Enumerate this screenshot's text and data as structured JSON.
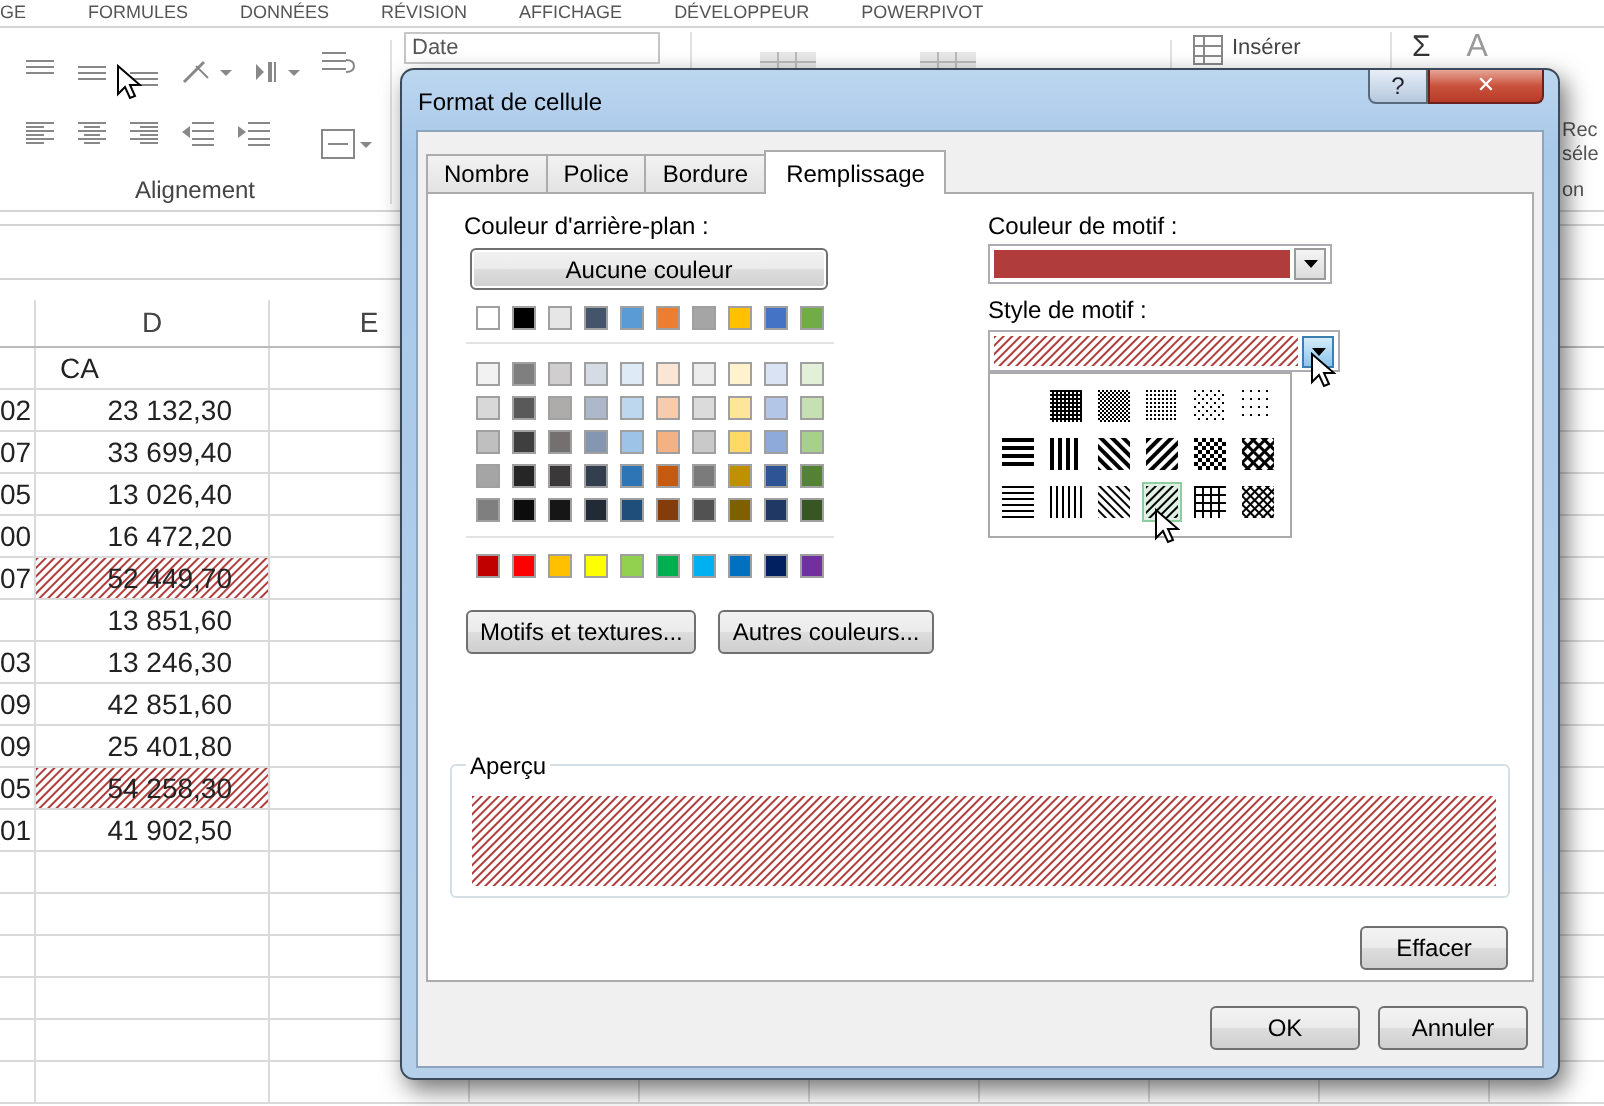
{
  "ribbon": {
    "tabs": [
      "GE",
      "FORMULES",
      "DONNÉES",
      "RÉVISION",
      "AFFICHAGE",
      "DÉVELOPPEUR",
      "POWERPIVOT"
    ],
    "alignment_group": {
      "label": "Alignement"
    },
    "number_format": {
      "value": "Date"
    },
    "insert_button": {
      "label": "Insérer"
    },
    "autosum": {
      "symbol": "Σ"
    },
    "sort": {
      "symbol": "A"
    },
    "editing_texts": [
      "Rec",
      "séle",
      "on"
    ]
  },
  "sheet": {
    "columns": [
      "D",
      "E"
    ],
    "rows": [
      {
        "column_1": "",
        "value": "CA",
        "hatched": false
      },
      {
        "column_1": "02",
        "value": "23 132,30",
        "hatched": false
      },
      {
        "column_1": "07",
        "value": "33 699,40",
        "hatched": false
      },
      {
        "column_1": "05",
        "value": "13 026,40",
        "hatched": false
      },
      {
        "column_1": "00",
        "value": "16 472,20",
        "hatched": false
      },
      {
        "column_1": "07",
        "value": "52 449,70",
        "hatched": true
      },
      {
        "column_1": "",
        "value": "13 851,60",
        "hatched": false
      },
      {
        "column_1": "03",
        "value": "13 246,30",
        "hatched": false
      },
      {
        "column_1": "09",
        "value": "42 851,60",
        "hatched": false
      },
      {
        "column_1": "09",
        "value": "25 401,80",
        "hatched": false
      },
      {
        "column_1": "05",
        "value": "54 258,30",
        "hatched": true
      },
      {
        "column_1": "01",
        "value": "41 902,50",
        "hatched": false
      }
    ]
  },
  "dialog": {
    "title": "Format de cellule",
    "help": "?",
    "close": "✕",
    "tabs": [
      {
        "label": "Nombre",
        "selected": false
      },
      {
        "label": "Police",
        "selected": false
      },
      {
        "label": "Bordure",
        "selected": false
      },
      {
        "label": "Remplissage",
        "selected": true
      }
    ],
    "background_label": "Couleur d'arrière-plan :",
    "no_color_button": "Aucune couleur",
    "theme_colors": [
      {
        "color": "#ffffff"
      },
      {
        "color": "#000000"
      },
      {
        "color": "#e7e6e6"
      },
      {
        "color": "#44546a"
      },
      {
        "color": "#5b9bd5"
      },
      {
        "color": "#ed7d31"
      },
      {
        "color": "#a5a5a5"
      },
      {
        "color": "#ffc000"
      },
      {
        "color": "#4472c4"
      },
      {
        "color": "#70ad47"
      }
    ],
    "shade_rows": [
      {
        "swatches": [
          {
            "color": "#f2f2f2"
          },
          {
            "color": "#7f7f7f"
          },
          {
            "color": "#d0cece"
          },
          {
            "color": "#d6dce4"
          },
          {
            "color": "#deebf6"
          },
          {
            "color": "#fbe5d5"
          },
          {
            "color": "#ededed"
          },
          {
            "color": "#fff2cc"
          },
          {
            "color": "#dae3f3"
          },
          {
            "color": "#e2efd9"
          }
        ]
      },
      {
        "swatches": [
          {
            "color": "#d8d8d8"
          },
          {
            "color": "#595959"
          },
          {
            "color": "#aeabab"
          },
          {
            "color": "#adb9ca"
          },
          {
            "color": "#bdd7ee"
          },
          {
            "color": "#f7cbac"
          },
          {
            "color": "#dbdbdb"
          },
          {
            "color": "#fee599"
          },
          {
            "color": "#b4c6e7"
          },
          {
            "color": "#c5e0b3"
          }
        ]
      },
      {
        "swatches": [
          {
            "color": "#bfbfbf"
          },
          {
            "color": "#3f3f3f"
          },
          {
            "color": "#757070"
          },
          {
            "color": "#8496b0"
          },
          {
            "color": "#9dc3e6"
          },
          {
            "color": "#f4b183"
          },
          {
            "color": "#c9c9c9"
          },
          {
            "color": "#ffd965"
          },
          {
            "color": "#8eaadb"
          },
          {
            "color": "#a8d08d"
          }
        ]
      },
      {
        "swatches": [
          {
            "color": "#a5a5a5"
          },
          {
            "color": "#262626"
          },
          {
            "color": "#3a3838"
          },
          {
            "color": "#333f4f"
          },
          {
            "color": "#2e75b5"
          },
          {
            "color": "#c55a11"
          },
          {
            "color": "#7b7b7b"
          },
          {
            "color": "#bf9000"
          },
          {
            "color": "#2f5496"
          },
          {
            "color": "#538135"
          }
        ]
      },
      {
        "swatches": [
          {
            "color": "#7f7f7f"
          },
          {
            "color": "#0c0c0c"
          },
          {
            "color": "#171616"
          },
          {
            "color": "#222a35"
          },
          {
            "color": "#1e4e79"
          },
          {
            "color": "#843c0b"
          },
          {
            "color": "#525252"
          },
          {
            "color": "#7f6000"
          },
          {
            "color": "#1f3864"
          },
          {
            "color": "#375623"
          }
        ]
      }
    ],
    "standard_colors": [
      {
        "color": "#c00000"
      },
      {
        "color": "#ff0000"
      },
      {
        "color": "#ffc000"
      },
      {
        "color": "#ffff00"
      },
      {
        "color": "#92d050"
      },
      {
        "color": "#00b050"
      },
      {
        "color": "#00b0f0"
      },
      {
        "color": "#0070c0"
      },
      {
        "color": "#002060"
      },
      {
        "color": "#7030a0"
      }
    ],
    "effects_button": "Motifs et textures...",
    "more_colors_button": "Autres couleurs...",
    "pattern_color_label": "Couleur de motif :",
    "pattern_color": {
      "color": "#b03c3c"
    },
    "pattern_style_label": "Style de motif :",
    "pattern_styles": [
      {
        "kind": "dots75",
        "selected": false
      },
      {
        "kind": "dots50",
        "selected": false
      },
      {
        "kind": "dots25",
        "selected": false
      },
      {
        "kind": "dots12",
        "selected": false
      },
      {
        "kind": "dots6",
        "selected": false
      },
      {
        "kind": "thick_h",
        "selected": false
      },
      {
        "kind": "thick_v",
        "selected": false
      },
      {
        "kind": "thick_rdiag",
        "selected": false
      },
      {
        "kind": "thick_diag",
        "selected": false
      },
      {
        "kind": "thick_checker",
        "selected": false
      },
      {
        "kind": "thick_cross",
        "selected": false
      },
      {
        "kind": "thin_h",
        "selected": false
      },
      {
        "kind": "thin_v",
        "selected": false
      },
      {
        "kind": "thin_rdiag",
        "selected": false
      },
      {
        "kind": "thin_diag",
        "selected": true
      },
      {
        "kind": "thin_grid",
        "selected": false
      },
      {
        "kind": "thin_cross",
        "selected": false
      }
    ],
    "preview_label": "Aperçu",
    "clear_button": "Effacer",
    "buttons": [
      "OK",
      "Annuler"
    ]
  }
}
